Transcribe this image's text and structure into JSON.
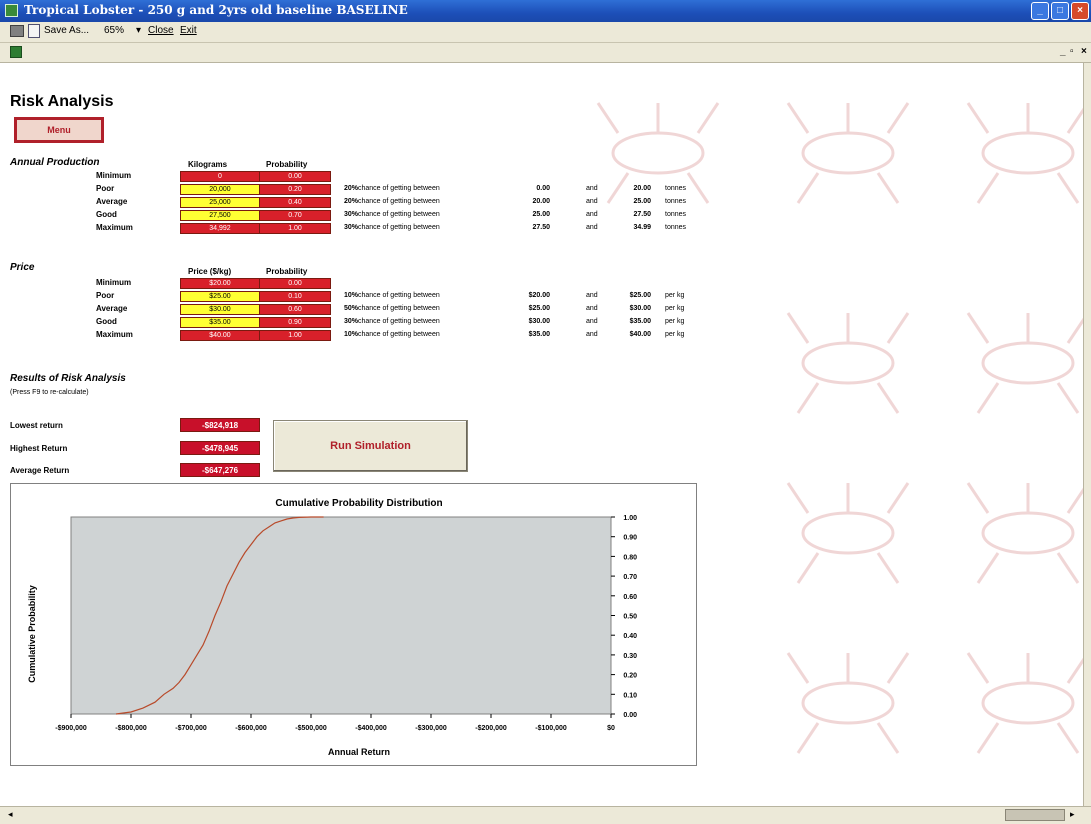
{
  "window": {
    "title": "Tropical Lobster - 250 g and 2yrs old baseline BASELINE"
  },
  "toolbar": {
    "save_as": "Save As...",
    "zoom": "65%",
    "close": "Close",
    "exit": "Exit"
  },
  "sheet": {
    "title": "Risk Analysis",
    "menu_button": "Menu",
    "production": {
      "heading": "Annual Production",
      "col_value": "Kilograms",
      "col_prob": "Probability",
      "rows": [
        {
          "label": "Minimum",
          "value": "0",
          "prob": "0.00"
        },
        {
          "label": "Poor",
          "value": "20,000",
          "prob": "0.20",
          "pct": "20%",
          "text": "chance of getting between",
          "from": "0.00",
          "and": "and",
          "to": "20.00",
          "unit": "tonnes"
        },
        {
          "label": "Average",
          "value": "25,000",
          "prob": "0.40",
          "pct": "20%",
          "text": "chance of getting between",
          "from": "20.00",
          "and": "and",
          "to": "25.00",
          "unit": "tonnes"
        },
        {
          "label": "Good",
          "value": "27,500",
          "prob": "0.70",
          "pct": "30%",
          "text": "chance of getting between",
          "from": "25.00",
          "and": "and",
          "to": "27.50",
          "unit": "tonnes"
        },
        {
          "label": "Maximum",
          "value": "34,992",
          "prob": "1.00",
          "pct": "30%",
          "text": "chance of getting between",
          "from": "27.50",
          "and": "and",
          "to": "34.99",
          "unit": "tonnes"
        }
      ]
    },
    "price": {
      "heading": "Price",
      "col_value": "Price ($/kg)",
      "col_prob": "Probability",
      "rows": [
        {
          "label": "Minimum",
          "value": "$20.00",
          "prob": "0.00"
        },
        {
          "label": "Poor",
          "value": "$25.00",
          "prob": "0.10",
          "pct": "10%",
          "text": "chance of getting between",
          "from": "$20.00",
          "and": "and",
          "to": "$25.00",
          "unit": "per kg"
        },
        {
          "label": "Average",
          "value": "$30.00",
          "prob": "0.60",
          "pct": "50%",
          "text": "chance of getting between",
          "from": "$25.00",
          "and": "and",
          "to": "$30.00",
          "unit": "per kg"
        },
        {
          "label": "Good",
          "value": "$35.00",
          "prob": "0.90",
          "pct": "30%",
          "text": "chance of getting between",
          "from": "$30.00",
          "and": "and",
          "to": "$35.00",
          "unit": "per kg"
        },
        {
          "label": "Maximum",
          "value": "$40.00",
          "prob": "1.00",
          "pct": "10%",
          "text": "chance of getting between",
          "from": "$35.00",
          "and": "and",
          "to": "$40.00",
          "unit": "per kg"
        }
      ]
    },
    "results": {
      "heading": "Results of Risk Analysis",
      "subheading": "(Press F9 to re-calculate)",
      "lowest_label": "Lowest return",
      "lowest_value": "-$824,918",
      "highest_label": "Highest Return",
      "highest_value": "-$478,945",
      "average_label": "Average Return",
      "average_value": "-$647,276",
      "run_button": "Run Simulation"
    }
  },
  "chart_data": {
    "type": "line",
    "title": "Cumulative Probability Distribution",
    "xlabel": "Annual Return",
    "ylabel": "Cumulative Probability",
    "xlim": [
      -900000,
      0
    ],
    "ylim": [
      0,
      1
    ],
    "x_ticks": [
      "-$900,000",
      "-$800,000",
      "-$700,000",
      "-$600,000",
      "-$500,000",
      "-$400,000",
      "-$300,000",
      "-$200,000",
      "-$100,000",
      "$0"
    ],
    "y_ticks": [
      "0.00",
      "0.10",
      "0.20",
      "0.30",
      "0.40",
      "0.50",
      "0.60",
      "0.70",
      "0.80",
      "0.90",
      "1.00"
    ],
    "plot_color": "#cfd3d4",
    "line_color": "#b84a2a",
    "series": [
      {
        "x": [
          -825000,
          -800000,
          -780000,
          -760000,
          -745000,
          -730000,
          -720000,
          -710000,
          -700000,
          -690000,
          -680000,
          -670000,
          -660000,
          -650000,
          -640000,
          -630000,
          -620000,
          -610000,
          -600000,
          -590000,
          -580000,
          -570000,
          -560000,
          -550000,
          -540000,
          -530000,
          -520000,
          -500000,
          -479000
        ],
        "y": [
          0.0,
          0.01,
          0.03,
          0.06,
          0.1,
          0.13,
          0.16,
          0.2,
          0.25,
          0.3,
          0.35,
          0.42,
          0.5,
          0.57,
          0.65,
          0.71,
          0.77,
          0.82,
          0.86,
          0.9,
          0.93,
          0.95,
          0.97,
          0.98,
          0.99,
          0.995,
          0.998,
          1.0,
          1.0
        ]
      }
    ]
  }
}
